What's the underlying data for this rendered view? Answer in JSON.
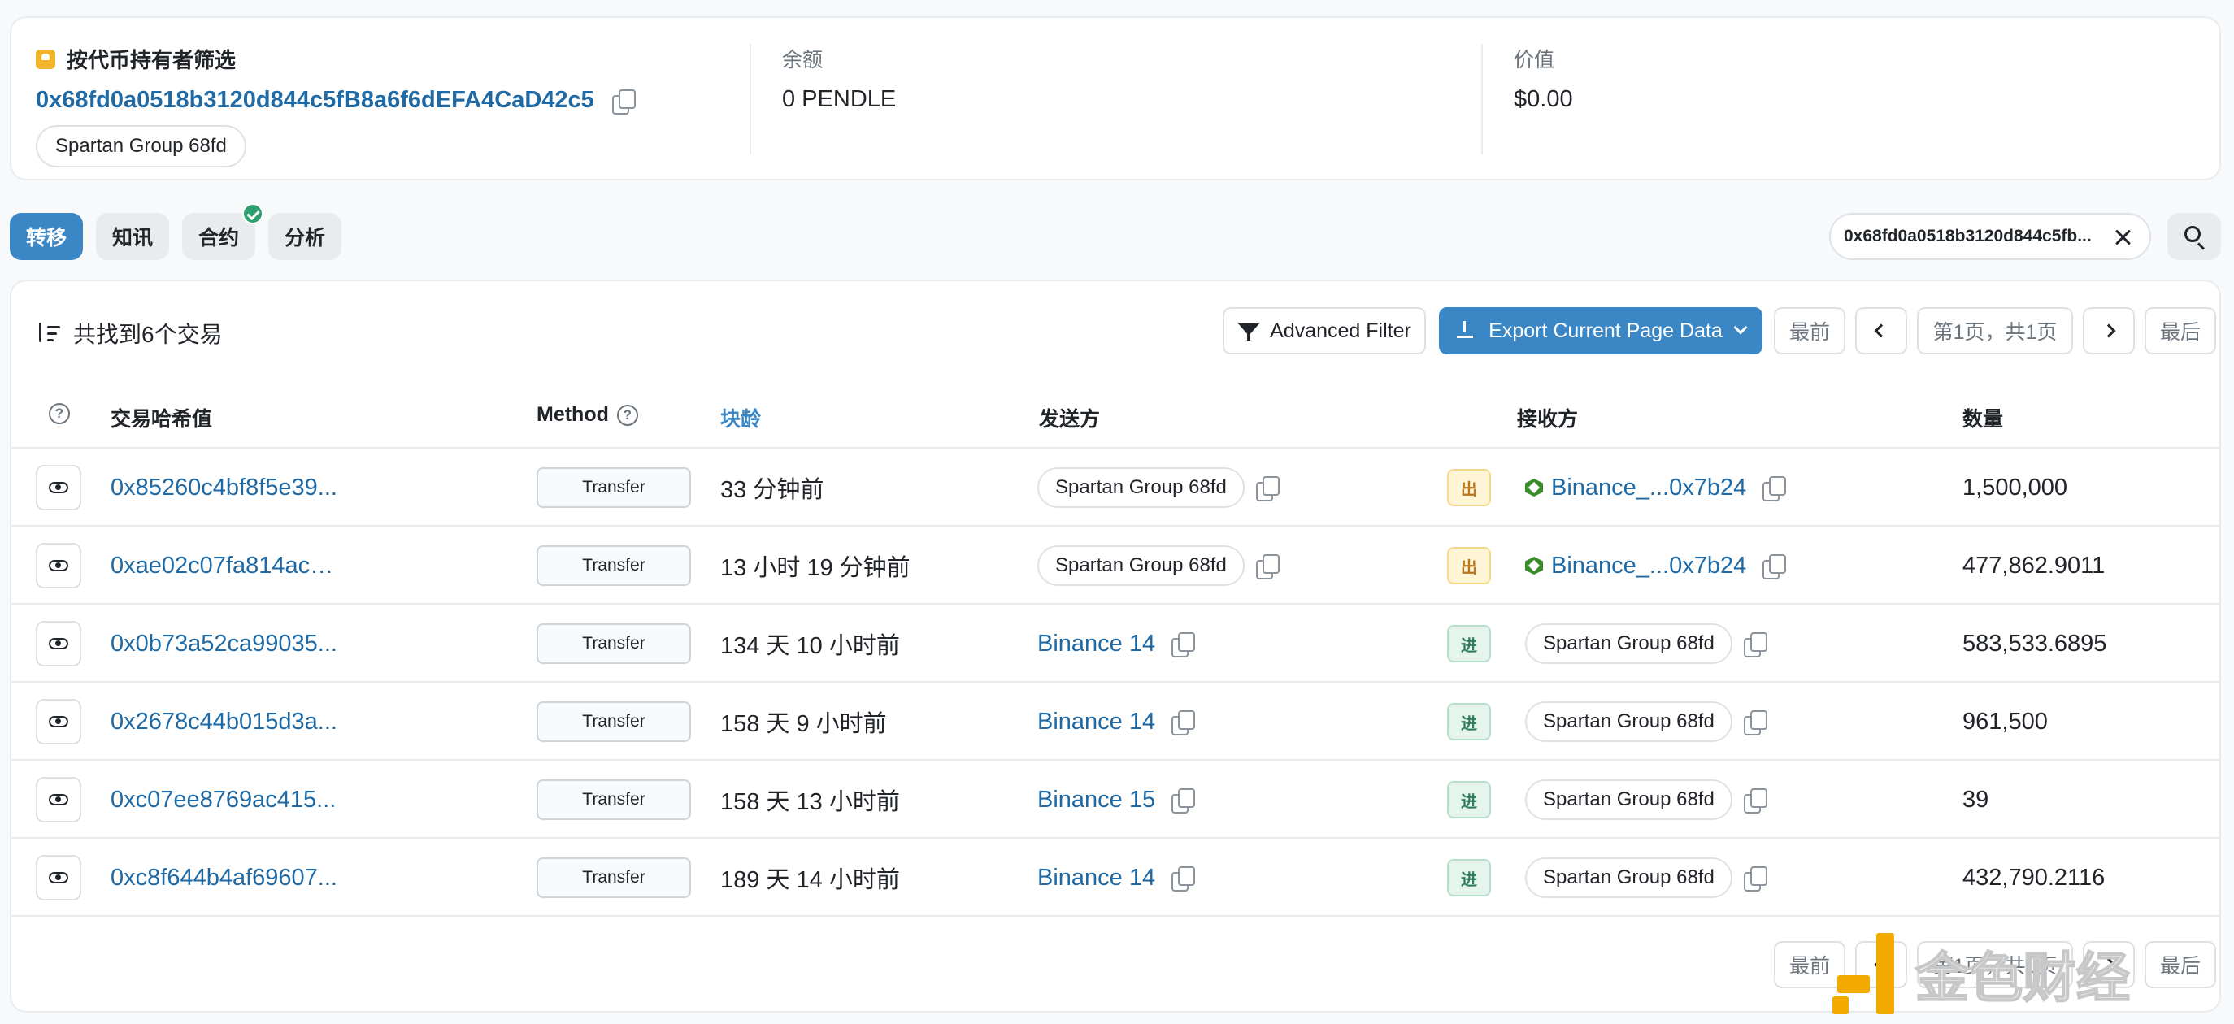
{
  "holder": {
    "title": "按代币持有者筛选",
    "address": "0x68fd0a0518b3120d844c5fB8a6f6dEFA4CaD42c5",
    "tag": "Spartan Group 68fd",
    "balance_label": "余额",
    "balance_value": "0 PENDLE",
    "value_label": "价值",
    "value_value": "$0.00"
  },
  "tabs": [
    {
      "label": "转移",
      "active": true
    },
    {
      "label": "知讯",
      "active": false
    },
    {
      "label": "合约",
      "active": false,
      "verified": true
    },
    {
      "label": "分析",
      "active": false
    }
  ],
  "filter": {
    "address": "0x68fd0a0518b3120d844c5fb..."
  },
  "toolbar": {
    "result_count": "共找到6个交易",
    "advanced_filter": "Advanced Filter",
    "export": "Export Current Page Data",
    "first": "最前",
    "page_info": "第1页，共1页",
    "last": "最后"
  },
  "columns": {
    "hash": "交易哈希值",
    "method": "Method",
    "age": "块龄",
    "from": "发送方",
    "to": "接收方",
    "amount": "数量"
  },
  "rows": [
    {
      "hash": "0x85260c4bf8f5e39...",
      "method": "Transfer",
      "age": "33 分钟前",
      "from": "Spartan Group 68fd",
      "from_type": "pill",
      "direction": "出",
      "to": "Binance_...0x7b24",
      "to_type": "link",
      "amount": "1,500,000"
    },
    {
      "hash": "0xae02c07fa814acc...",
      "method": "Transfer",
      "age": "13 小时 19 分钟前",
      "from": "Spartan Group 68fd",
      "from_type": "pill",
      "direction": "出",
      "to": "Binance_...0x7b24",
      "to_type": "link",
      "amount": "477,862.9011"
    },
    {
      "hash": "0x0b73a52ca99035...",
      "method": "Transfer",
      "age": "134 天 10 小时前",
      "from": "Binance 14",
      "from_type": "link",
      "direction": "进",
      "to": "Spartan Group 68fd",
      "to_type": "pill",
      "amount": "583,533.6895"
    },
    {
      "hash": "0x2678c44b015d3a...",
      "method": "Transfer",
      "age": "158 天 9 小时前",
      "from": "Binance 14",
      "from_type": "link",
      "direction": "进",
      "to": "Spartan Group 68fd",
      "to_type": "pill",
      "amount": "961,500"
    },
    {
      "hash": "0xc07ee8769ac415...",
      "method": "Transfer",
      "age": "158 天 13 小时前",
      "from": "Binance 15",
      "from_type": "link",
      "direction": "进",
      "to": "Spartan Group 68fd",
      "to_type": "pill",
      "amount": "39"
    },
    {
      "hash": "0xc8f644b4af69607...",
      "method": "Transfer",
      "age": "189 天 14 小时前",
      "from": "Binance 14",
      "from_type": "link",
      "direction": "进",
      "to": "Spartan Group 68fd",
      "to_type": "pill",
      "amount": "432,790.2116"
    }
  ],
  "watermark": "金色财经",
  "colors": {
    "accent": "#3b86c4",
    "link": "#1f6aa5",
    "out": "#b7791f",
    "in": "#2f7d5a"
  }
}
